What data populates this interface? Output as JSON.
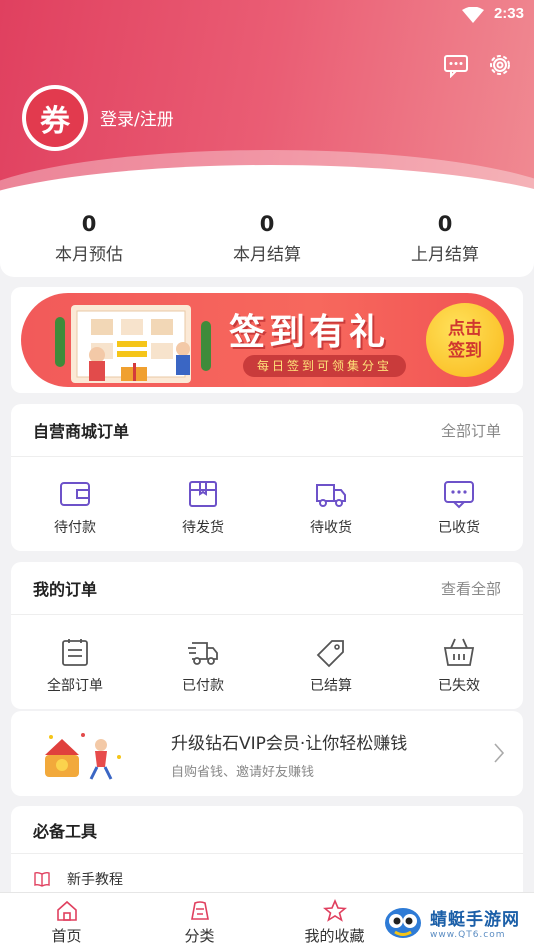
{
  "status_bar": {
    "time": "2:33"
  },
  "header": {
    "avatar_char": "券",
    "login_text": "登录/注册",
    "message_icon": "message-icon",
    "settings_icon": "gear-icon"
  },
  "stats": [
    {
      "value": "0",
      "label": "本月预估"
    },
    {
      "value": "0",
      "label": "本月结算"
    },
    {
      "value": "0",
      "label": "上月结算"
    }
  ],
  "banner": {
    "title": "签到有礼",
    "subtitle": "每日签到可领集分宝",
    "button_line1": "点击",
    "button_line2": "签到"
  },
  "self_orders": {
    "title": "自营商城订单",
    "link": "全部订单",
    "items": [
      {
        "label": "待付款",
        "icon": "wallet-icon"
      },
      {
        "label": "待发货",
        "icon": "box-icon"
      },
      {
        "label": "待收货",
        "icon": "truck-icon"
      },
      {
        "label": "已收货",
        "icon": "chat-check-icon"
      }
    ]
  },
  "my_orders": {
    "title": "我的订单",
    "link": "查看全部",
    "items": [
      {
        "label": "全部订单",
        "icon": "list-icon"
      },
      {
        "label": "已付款",
        "icon": "delivery-icon"
      },
      {
        "label": "已结算",
        "icon": "tag-icon"
      },
      {
        "label": "已失效",
        "icon": "basket-icon"
      }
    ]
  },
  "vip": {
    "title": "升级钻石VIP会员·让你轻松赚钱",
    "subtitle": "自购省钱、邀请好友赚钱"
  },
  "tools": {
    "title": "必备工具",
    "items": [
      {
        "label": "新手教程",
        "icon": "book-icon"
      }
    ]
  },
  "tabbar": [
    {
      "label": "首页",
      "icon": "home-icon"
    },
    {
      "label": "分类",
      "icon": "category-icon"
    },
    {
      "label": "我的收藏",
      "icon": "star-icon"
    }
  ],
  "watermark": {
    "title": "蜻蜓手游网",
    "url": "www.QT6.com"
  },
  "colors": {
    "brand": "#e0405f",
    "accent": "#7a5cd6",
    "icon_purple": "#6d52c9"
  }
}
